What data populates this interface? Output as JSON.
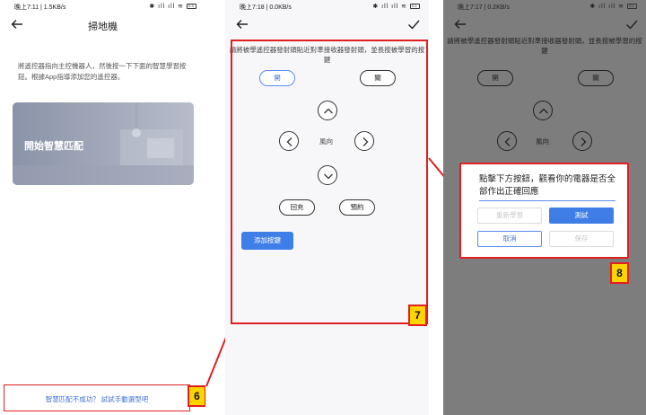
{
  "phone1": {
    "status_time": "晚上7:11 | 1.5KB/s",
    "status_right": "✱ ıll ıll ≋",
    "battery": "53",
    "title": "掃地機",
    "description": "將遙控器指向主控機器人，然後按一下下面的智慧學習按鈕。根據App指導添加您的遙控器。",
    "match_card_label": "開始智慧匹配",
    "fallback_link": "智慧匹配不成功？ 試試手動選型吧",
    "badge": "6"
  },
  "phone2": {
    "status_time": "晚上7:18 | 0.0KB/s",
    "status_right": "✱ ıll ıll ≋",
    "battery": "51",
    "instruction": "請將被學遙控器發射頭貼近對準接收器發射頭，並長按被學習的按鍵",
    "on_label": "開",
    "off_label": "關",
    "center_label": "風向",
    "recharge_label": "回充",
    "schedule_label": "預約",
    "add_button_label": "添加按鍵",
    "badge": "7"
  },
  "phone3": {
    "status_time": "晚上7:17 | 0.2KB/s",
    "status_right": "✱ ıll ıll ≋",
    "battery": "51",
    "instruction": "請將被學遙控器發射頭貼近對準接收器發射頭，並長按被學習的按鍵",
    "on_label": "開",
    "off_label": "關",
    "center_label": "風向",
    "badge": "8",
    "dialog": {
      "message": "點擊下方按鈕，觀看你的電器是否全部作出正確回應",
      "relearn_label": "重新學習",
      "test_label": "測試",
      "cancel_label": "取消",
      "save_label": "保存"
    }
  },
  "colors": {
    "accent": "#3f7ee6",
    "highlight_border": "#e02020",
    "badge_fill": "#ffd400"
  }
}
